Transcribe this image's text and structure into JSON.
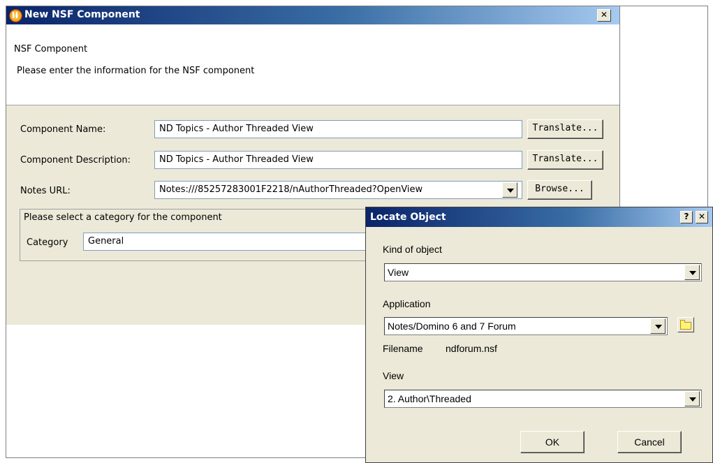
{
  "nsf_dialog": {
    "title": "New NSF Component",
    "close_glyph": "✕",
    "header_title": "NSF Component",
    "header_subtitle": "Please enter the information for the NSF component",
    "component_name_label": "Component Name:",
    "component_name_value": "ND Topics - Author Threaded View",
    "component_description_label": "Component Description:",
    "component_description_value": "ND Topics - Author Threaded View",
    "notes_url_label": "Notes URL:",
    "notes_url_value": "Notes:///85257283001F2218/nAuthorThreaded?OpenView",
    "translate_label": "Translate...",
    "browse_label": "Browse...",
    "category_group_label": "Please select a category for the component",
    "category_label": "Category",
    "category_value": "General"
  },
  "locate_dialog": {
    "title": "Locate Object",
    "help_glyph": "?",
    "close_glyph": "✕",
    "kind_label": "Kind of object",
    "kind_value": "View",
    "application_label": "Application",
    "application_value": "Notes/Domino 6 and 7 Forum",
    "filename_label": "Filename",
    "filename_value": "ndforum.nsf",
    "view_label": "View",
    "view_value": "2. Author\\Threaded",
    "ok_label": "OK",
    "cancel_label": "Cancel"
  },
  "icons": {
    "app_icon": "notes-app-icon",
    "folder_icon": "folder-icon",
    "dropdown_icon": "chevron-down-icon"
  }
}
